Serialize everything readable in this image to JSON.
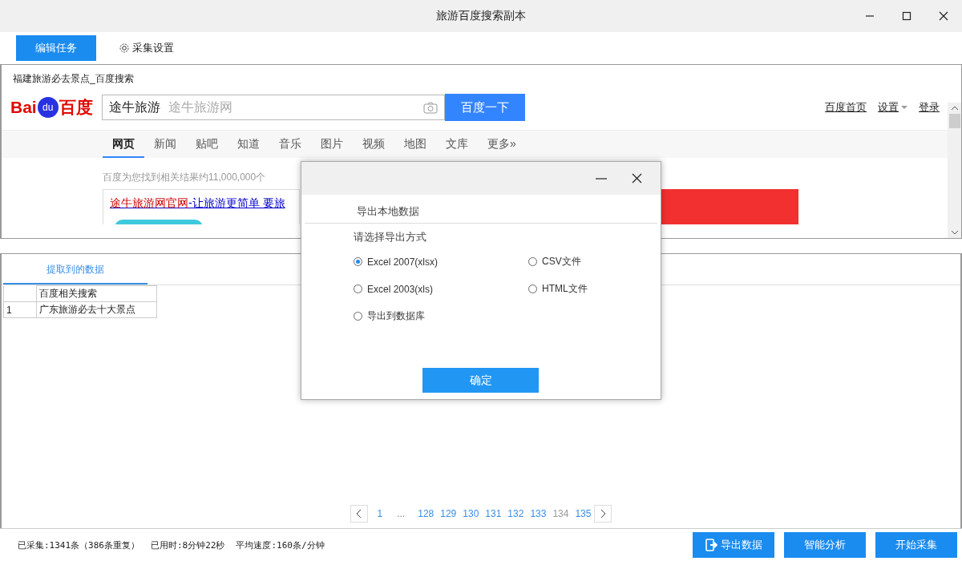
{
  "window": {
    "title": "旅游百度搜索副本"
  },
  "toolbar": {
    "buttons": [
      {
        "label": "编辑任务",
        "kind": "primary"
      },
      {
        "label": "采集设置",
        "kind": "settings"
      }
    ]
  },
  "browser": {
    "page_title": "福建旅游必去景点_百度搜索",
    "logo": {
      "left": "Bai",
      "badge": "du",
      "right": "百度"
    },
    "search": {
      "value": "途牛旅游",
      "suggestion": "途牛旅游网",
      "button": "百度一下"
    },
    "top_links": [
      {
        "label": "百度首页",
        "dropdown": false
      },
      {
        "label": "设置",
        "dropdown": true
      },
      {
        "label": "登录",
        "dropdown": false
      }
    ],
    "nav_tabs": [
      {
        "label": "网页",
        "selected": true
      },
      {
        "label": "新闻",
        "selected": false
      },
      {
        "label": "贴吧",
        "selected": false
      },
      {
        "label": "知道",
        "selected": false
      },
      {
        "label": "音乐",
        "selected": false
      },
      {
        "label": "图片",
        "selected": false
      },
      {
        "label": "视频",
        "selected": false
      },
      {
        "label": "地图",
        "selected": false
      },
      {
        "label": "文库",
        "selected": false
      },
      {
        "label": "更多»",
        "selected": false
      }
    ],
    "result_count": "百度为您找到相关结果约11,000,000个",
    "ad": {
      "title_brand": "途牛旅游网官网",
      "title_rest": "-让旅游更简单 要旅"
    }
  },
  "data_tabs": [
    {
      "label": "提取到的数据",
      "selected": true
    }
  ],
  "table": {
    "columns": [
      "百度相关搜索"
    ],
    "rows": [
      {
        "index": "1",
        "cells": [
          "广东旅游必去十大景点"
        ]
      }
    ]
  },
  "pagination": {
    "pages": [
      {
        "label": "1",
        "kind": "page",
        "selected": false
      },
      {
        "label": "...",
        "kind": "ellipsis"
      },
      {
        "label": "128",
        "kind": "page",
        "selected": false
      },
      {
        "label": "129",
        "kind": "page",
        "selected": false
      },
      {
        "label": "130",
        "kind": "page",
        "selected": false
      },
      {
        "label": "131",
        "kind": "page",
        "selected": false
      },
      {
        "label": "132",
        "kind": "page",
        "selected": false
      },
      {
        "label": "133",
        "kind": "page",
        "selected": false
      },
      {
        "label": "134",
        "kind": "page",
        "selected": true
      },
      {
        "label": "135",
        "kind": "page",
        "selected": false
      }
    ]
  },
  "status_bar": {
    "stats": [
      "已采集:1341条（386条重复）",
      "已用时:8分钟22秒",
      "平均速度:160条/分钟"
    ],
    "buttons": [
      {
        "label": "导出数据",
        "kind": "export"
      },
      {
        "label": "智能分析",
        "kind": "plain"
      },
      {
        "label": "开始采集",
        "kind": "plain"
      }
    ]
  },
  "dialog": {
    "heading": "导出本地数据",
    "prompt": "请选择导出方式",
    "options": [
      {
        "label": "Excel 2007(xlsx)",
        "selected": true
      },
      {
        "label": "CSV文件",
        "selected": false
      },
      {
        "label": "Excel 2003(xls)",
        "selected": false
      },
      {
        "label": "HTML文件",
        "selected": false
      },
      {
        "label": "导出到数据库",
        "selected": false
      }
    ],
    "confirm": "确定"
  }
}
